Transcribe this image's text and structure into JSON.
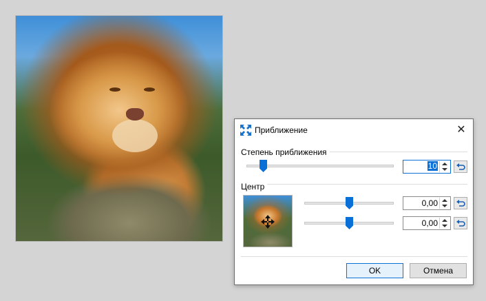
{
  "canvas": {
    "image_subject": "lion"
  },
  "dialog": {
    "title": "Приближение",
    "title_icon": "zoom-expand-icon",
    "close_icon": "close-icon",
    "close_glyph": "✕",
    "zoom_section": {
      "label": "Степень приближения",
      "value": "10"
    },
    "center_section": {
      "label": "Центр",
      "x_value": "0,00",
      "y_value": "0,00"
    },
    "buttons": {
      "ok": "OK",
      "cancel": "Отмена"
    }
  },
  "colors": {
    "accent": "#0a6fd6",
    "background": "#d4d4d4",
    "dialog_bg": "#ffffff"
  }
}
